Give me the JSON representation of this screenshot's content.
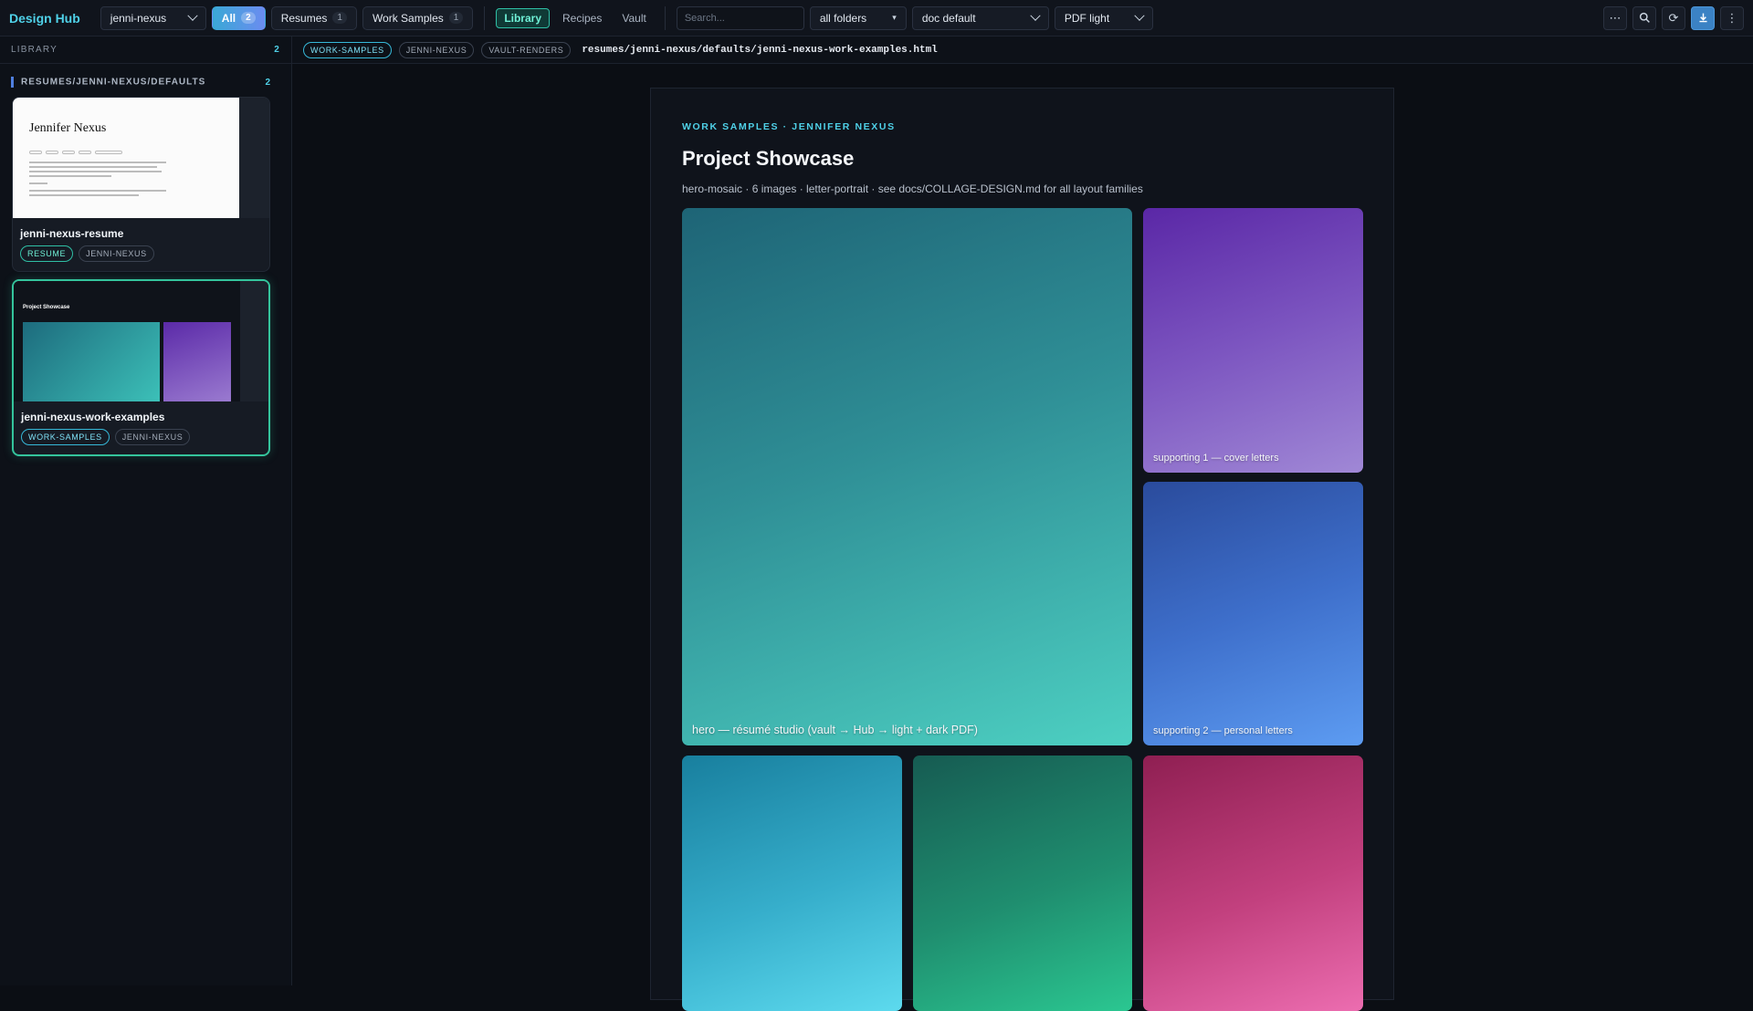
{
  "app": {
    "brand": "Design Hub",
    "workspace": "jenni-nexus"
  },
  "filters": [
    {
      "label": "All",
      "count": "2",
      "active": true
    },
    {
      "label": "Resumes",
      "count": "1",
      "active": false
    },
    {
      "label": "Work Samples",
      "count": "1",
      "active": false
    }
  ],
  "nav": {
    "library": "Library",
    "recipes": "Recipes",
    "vault": "Vault"
  },
  "search": {
    "placeholder": "Search..."
  },
  "selects": {
    "folders": "all folders",
    "doc": "doc default",
    "pdf": "PDF light"
  },
  "toolbar": {
    "more_icon": "ellipsis-icon",
    "search_icon": "search-icon",
    "refresh_icon": "refresh-icon",
    "download_icon": "download-icon",
    "menu_icon": "kebab-menu-icon"
  },
  "sidebar": {
    "heading": "LIBRARY",
    "count": "2",
    "group": {
      "label": "RESUMES/JENNI-NEXUS/DEFAULTS",
      "count": "2"
    },
    "items": [
      {
        "title": "jenni-nexus-resume",
        "tags": [
          "RESUME",
          "JENNI-NEXUS"
        ],
        "thumb_name": "Jennifer Nexus"
      },
      {
        "title": "jenni-nexus-work-examples",
        "tags": [
          "WORK-SAMPLES",
          "JENNI-NEXUS"
        ],
        "thumb_title": "Project Showcase"
      }
    ]
  },
  "pathbar": {
    "tags": [
      "WORK-SAMPLES",
      "JENNI-NEXUS",
      "VAULT-RENDERS"
    ],
    "path": "resumes/jenni-nexus/defaults/jenni-nexus-work-examples.html"
  },
  "preview": {
    "eyebrow": "WORK SAMPLES · JENNIFER NEXUS",
    "title": "Project Showcase",
    "meta": "hero-mosaic · 6 images · letter-portrait · see docs/COLLAGE-DESIGN.md for all layout families",
    "tiles": [
      {
        "caption": "hero — résumé studio (vault → Hub → light + dark PDF)"
      },
      {
        "caption": "supporting 1 — cover letters"
      },
      {
        "caption": "supporting 2 — personal letters"
      },
      {
        "caption": ""
      },
      {
        "caption": ""
      },
      {
        "caption": ""
      }
    ]
  },
  "colors": {
    "accent": "#4fd1e8",
    "selection": "#34c49c",
    "background": "#0b0e14"
  }
}
